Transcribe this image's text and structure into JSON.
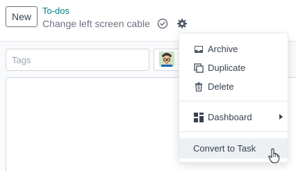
{
  "header": {
    "new_button_label": "New",
    "breadcrumb_parent": "To-dos",
    "record_title": "Change left screen cable"
  },
  "form": {
    "tags_placeholder": "Tags"
  },
  "menu": {
    "archive_label": "Archive",
    "duplicate_label": "Duplicate",
    "delete_label": "Delete",
    "dashboard_label": "Dashboard",
    "convert_label": "Convert to Task"
  },
  "colors": {
    "link": "#017e84",
    "menu_hover": "#edf0f3",
    "border": "#d1d5db"
  },
  "icons": [
    "check-circle-icon",
    "gear-icon",
    "inbox-icon",
    "copy-icon",
    "trash-icon",
    "dashboard-icon",
    "chevron-right-icon",
    "hand-pointer-icon"
  ]
}
